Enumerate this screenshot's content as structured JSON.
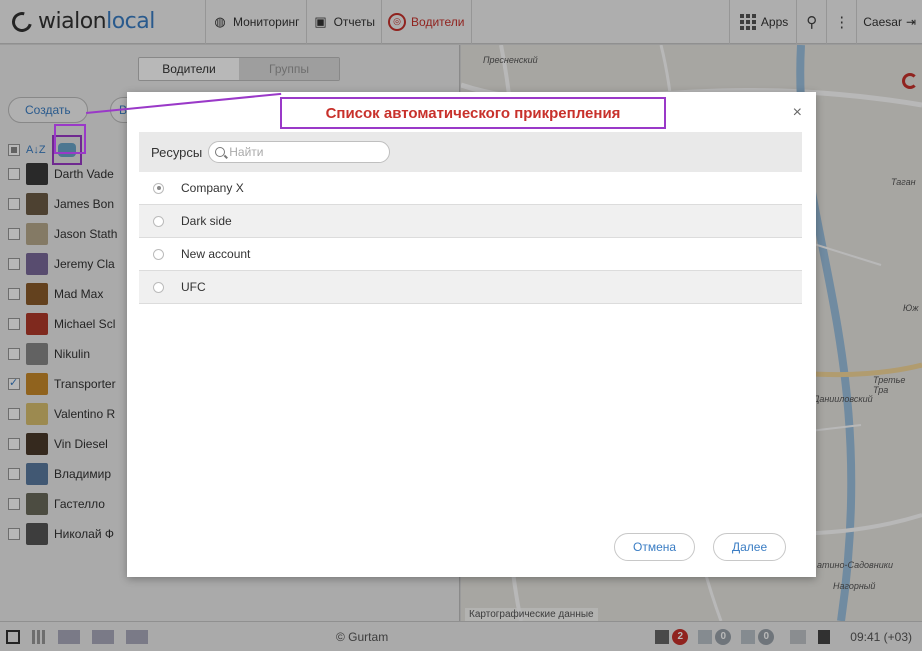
{
  "logo": {
    "text_a": "wialon",
    "text_b": "local"
  },
  "nav": [
    {
      "label": "Мониторинг"
    },
    {
      "label": "Отчеты"
    },
    {
      "label": "Водители"
    }
  ],
  "apps_label": "Apps",
  "user_label": "Caesar",
  "tabs": {
    "drivers": "Водители",
    "groups": "Группы"
  },
  "create_label": "Создать",
  "create_label2": "В",
  "drivers": [
    {
      "name": "Darth Vade",
      "avatar_color": "#3a3a3a",
      "checked": false
    },
    {
      "name": "James Bon",
      "avatar_color": "#6b5b45",
      "checked": false
    },
    {
      "name": "Jason Stath",
      "avatar_color": "#b8a98c",
      "checked": false
    },
    {
      "name": "Jeremy Cla",
      "avatar_color": "#7a6a9a",
      "checked": false
    },
    {
      "name": "Mad Max",
      "avatar_color": "#8a5a2a",
      "checked": false
    },
    {
      "name": "Michael Scl",
      "avatar_color": "#b03a2a",
      "checked": false
    },
    {
      "name": "Nikulin",
      "avatar_color": "#888888",
      "checked": false
    },
    {
      "name": "Transporter",
      "avatar_color": "#c88a2a",
      "checked": true
    },
    {
      "name": "Valentino R",
      "avatar_color": "#d8c070",
      "checked": false
    },
    {
      "name": "Vin Diesel",
      "avatar_color": "#4a3a2a",
      "checked": false
    },
    {
      "name": "Владимир",
      "avatar_color": "#5a7aa0",
      "checked": false
    },
    {
      "name": "Гастелло",
      "avatar_color": "#6a6a5a",
      "checked": false
    },
    {
      "name": "Николай Ф",
      "avatar_color": "#555555",
      "checked": false
    }
  ],
  "map": {
    "labels": [
      "Пресненский",
      "Таган",
      "Данииловский",
      "Третье Тра",
      "Юж",
      "атино-Садовники",
      "Нагорный"
    ],
    "copyright": "Картографические данные"
  },
  "callout": "Список автоматического прикрепления",
  "modal": {
    "close": "×",
    "resources_label": "Ресурсы",
    "search_placeholder": "Найти",
    "resources": [
      {
        "name": "Company X",
        "selected": true
      },
      {
        "name": "Dark side",
        "selected": false
      },
      {
        "name": "New account",
        "selected": false
      },
      {
        "name": "UFC",
        "selected": false
      }
    ],
    "cancel": "Отмена",
    "next": "Далее"
  },
  "bottom": {
    "copyright": "© Gurtam",
    "notifications": "2",
    "messages": "0",
    "events": "0",
    "time": "09:41 (+03)"
  },
  "colors": {
    "accent": "#3a7dc4",
    "active": "#c8312b",
    "callout_border": "#9a39c8"
  }
}
